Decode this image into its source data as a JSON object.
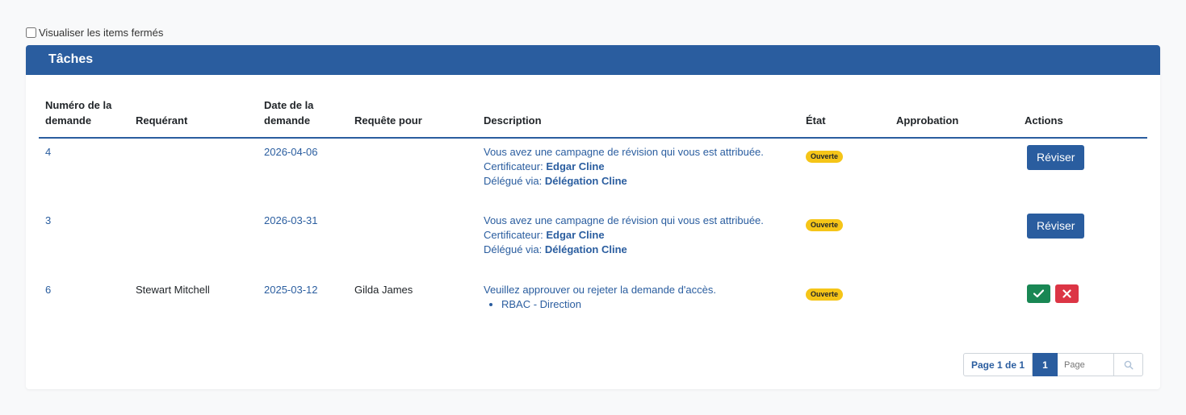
{
  "filters": {
    "show_closed_label": "Visualiser les items fermés",
    "show_closed_checked": false
  },
  "panel": {
    "title": "Tâches"
  },
  "table": {
    "columns": {
      "request_number": "Numéro de la demande",
      "requester": "Requérant",
      "request_date": "Date de la demande",
      "request_for": "Requête pour",
      "description": "Description",
      "state": "État",
      "approval": "Approbation",
      "actions": "Actions"
    },
    "rows": [
      {
        "number": "4",
        "requester": "",
        "date": "2026-04-06",
        "request_for": "",
        "description": "Vous avez une campagne de révision qui vous est attribuée.",
        "certifier_label": "Certificateur:",
        "certifier": "Edgar Cline",
        "delegated_label": "Délégué via:",
        "delegated": "Délégation Cline",
        "state": "Ouverte",
        "approval": "",
        "action_label": "Réviser"
      },
      {
        "number": "3",
        "requester": "",
        "date": "2026-03-31",
        "request_for": "",
        "description": "Vous avez une campagne de révision qui vous est attribuée.",
        "certifier_label": "Certificateur:",
        "certifier": "Edgar Cline",
        "delegated_label": "Délégué via:",
        "delegated": "Délégation Cline",
        "state": "Ouverte",
        "approval": "",
        "action_label": "Réviser"
      },
      {
        "number": "6",
        "requester": "Stewart Mitchell",
        "date": "2025-03-12",
        "request_for": "Gilda James",
        "description": "Veuillez approuver ou rejeter la demande d'accès.",
        "items": [
          "RBAC - Direction"
        ],
        "state": "Ouverte",
        "approval": "",
        "actions": [
          "approve-icon",
          "reject-icon"
        ]
      }
    ]
  },
  "pagination": {
    "page_info": "Page 1 de 1",
    "current_page": "1",
    "input_placeholder": "Page",
    "search_icon": "search-icon"
  },
  "colors": {
    "primary": "#2a5d9f",
    "badge_open": "#f5c518",
    "approve": "#198754",
    "reject": "#dc3545"
  }
}
